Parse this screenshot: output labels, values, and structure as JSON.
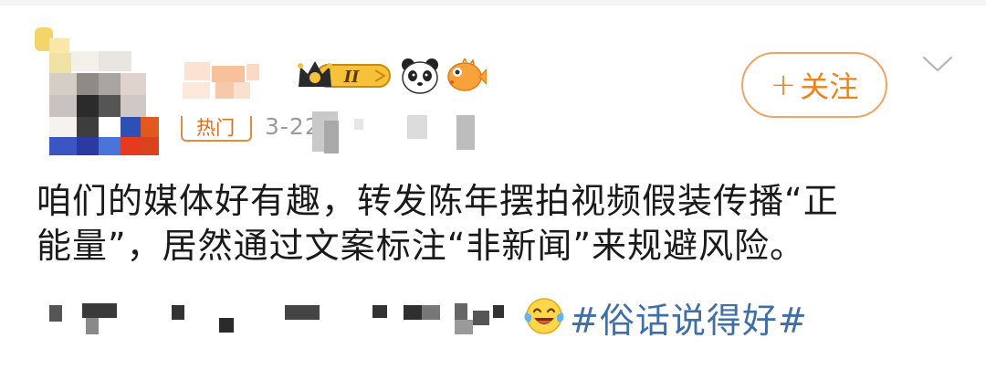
{
  "post": {
    "hot_label": "热门",
    "date": "3-22",
    "follow_label": "关注",
    "follow_plus": "+",
    "text_line1": "咱们的媒体好有趣，转发陈年摆拍视频假装传播“正",
    "text_line2": "能量”，居然通过文案标注“非新闻”来规避风险。",
    "topic": "#俗话说得好#"
  },
  "icons": {
    "badge": "crown-level-ii-badge-icon",
    "panda": "panda-icon",
    "fish": "pufferfish-icon",
    "laugh": "laugh-cry-emoji-icon",
    "more": "chevron-down-icon"
  },
  "colors": {
    "accent": "#f08219",
    "topic": "#3f6ea8",
    "meta": "#9b9b9b",
    "text": "#1a1a1a"
  }
}
